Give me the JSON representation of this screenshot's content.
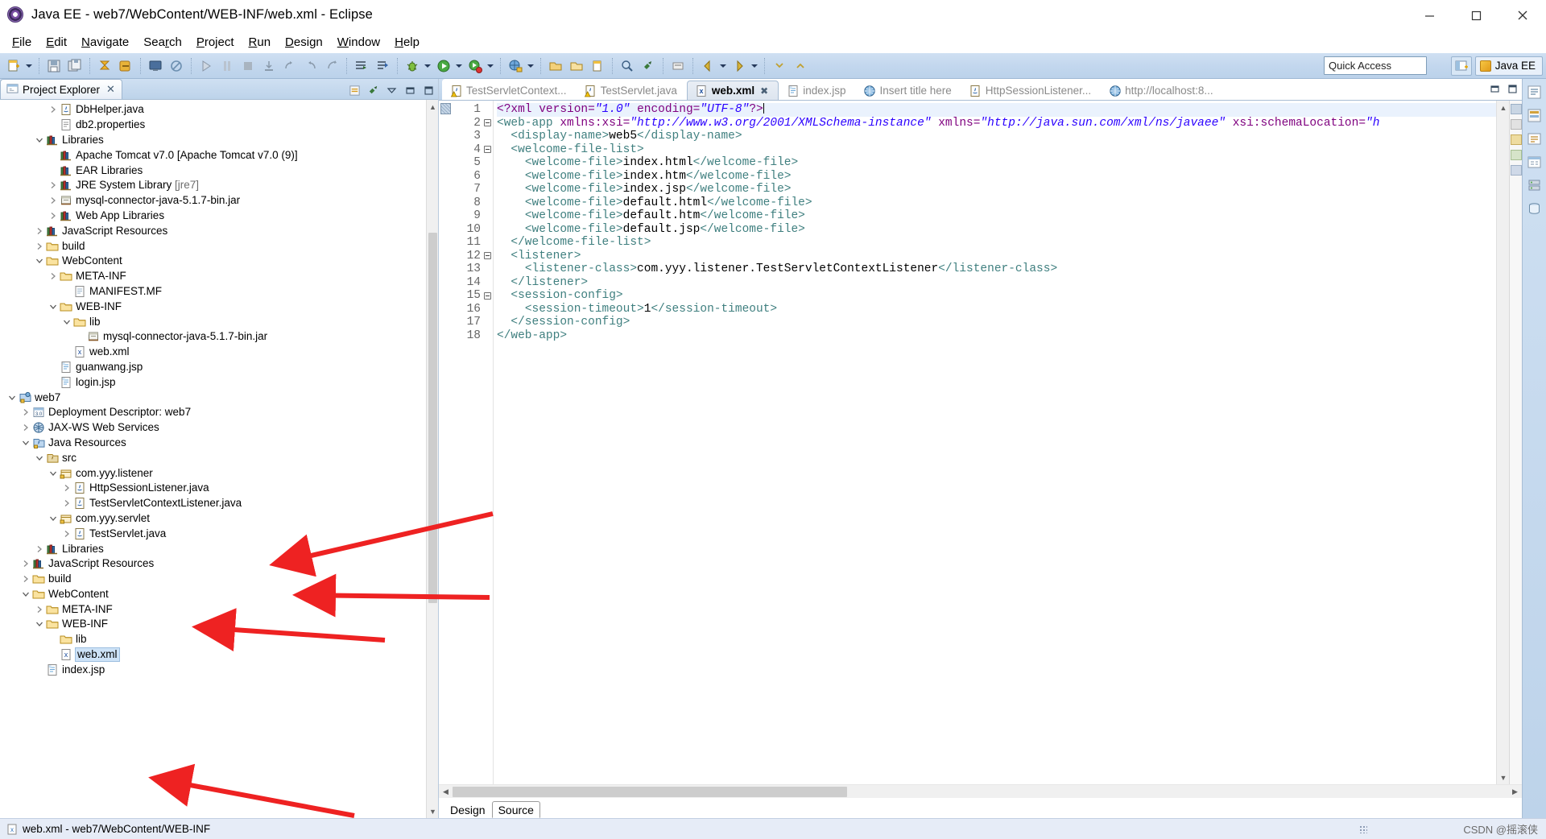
{
  "window": {
    "title": "Java EE - web7/WebContent/WEB-INF/web.xml - Eclipse",
    "app_icon": "eclipse-logo-icon",
    "minimize": "–",
    "maximize": "❐",
    "close": "✕"
  },
  "menubar": {
    "items": [
      {
        "label": "File",
        "mnemonic": "F"
      },
      {
        "label": "Edit",
        "mnemonic": "E"
      },
      {
        "label": "Navigate",
        "mnemonic": "N"
      },
      {
        "label": "Search",
        "mnemonic": "r"
      },
      {
        "label": "Project",
        "mnemonic": "P"
      },
      {
        "label": "Run",
        "mnemonic": "R"
      },
      {
        "label": "Design",
        "mnemonic": "D"
      },
      {
        "label": "Window",
        "mnemonic": "W"
      },
      {
        "label": "Help",
        "mnemonic": "H"
      }
    ]
  },
  "toolbar": {
    "quick_access_placeholder": "Quick Access",
    "perspective_label": "Java EE",
    "open_perspective_tooltip": "Open Perspective",
    "icons": [
      "new-wizard-icon",
      "save-icon",
      "save-all-icon",
      "publish-icon",
      "publish-all-icon",
      "console-icon",
      "no-sign-icon",
      "run-server-icon",
      "pause-icon",
      "stop-icon",
      "step-into-icon",
      "step-over-icon",
      "step-return-icon",
      "resume-icon",
      "open-type-icon",
      "open-task-icon",
      "debug-icon",
      "run-icon",
      "run-config-icon",
      "external-tools-icon",
      "new-java-project-icon",
      "new-package-icon",
      "new-class-icon",
      "search-icon",
      "link-icon",
      "back-icon",
      "forward-icon",
      "annotation-icon",
      "next-annotation-icon",
      "prev-annotation-icon"
    ]
  },
  "project_explorer": {
    "tab_title": "Project Explorer",
    "tab_icon": "project-explorer-icon",
    "tab_close": "✕",
    "tools": [
      "collapse-all-icon",
      "link-with-editor-icon",
      "view-menu-icon",
      "minimize-icon",
      "maximize-icon"
    ],
    "rows": [
      {
        "indent": 3,
        "twist": "collapsed",
        "icon": "java-file-icon",
        "label": "DbHelper.java",
        "selected": false
      },
      {
        "indent": 3,
        "twist": "none",
        "icon": "properties-icon",
        "label": "db2.properties",
        "selected": false
      },
      {
        "indent": 2,
        "twist": "expanded",
        "icon": "libraries-icon",
        "label": "Libraries",
        "selected": false
      },
      {
        "indent": 3,
        "twist": "none",
        "icon": "library-icon",
        "label": "Apache Tomcat v7.0 [Apache Tomcat v7.0 (9)]",
        "selected": false
      },
      {
        "indent": 3,
        "twist": "none",
        "icon": "library-icon",
        "label": "EAR Libraries",
        "selected": false
      },
      {
        "indent": 3,
        "twist": "collapsed",
        "icon": "library-icon",
        "label": "JRE System Library ",
        "label_dim": "[jre7]",
        "selected": false
      },
      {
        "indent": 3,
        "twist": "collapsed",
        "icon": "jar-icon",
        "label": "mysql-connector-java-5.1.7-bin.jar",
        "selected": false
      },
      {
        "indent": 3,
        "twist": "collapsed",
        "icon": "library-icon",
        "label": "Web App Libraries",
        "selected": false
      },
      {
        "indent": 2,
        "twist": "collapsed",
        "icon": "libraries-icon",
        "label": "JavaScript Resources",
        "selected": false
      },
      {
        "indent": 2,
        "twist": "collapsed",
        "icon": "folder-icon",
        "label": "build",
        "selected": false
      },
      {
        "indent": 2,
        "twist": "expanded",
        "icon": "folder-icon",
        "label": "WebContent",
        "selected": false
      },
      {
        "indent": 3,
        "twist": "collapsed",
        "icon": "folder-icon",
        "label": "META-INF",
        "selected": false
      },
      {
        "indent": 4,
        "twist": "none",
        "icon": "file-icon",
        "label": "MANIFEST.MF",
        "selected": false
      },
      {
        "indent": 3,
        "twist": "expanded",
        "icon": "folder-icon",
        "label": "WEB-INF",
        "selected": false
      },
      {
        "indent": 4,
        "twist": "expanded",
        "icon": "folder-icon",
        "label": "lib",
        "selected": false
      },
      {
        "indent": 5,
        "twist": "none",
        "icon": "jar-icon",
        "label": "mysql-connector-java-5.1.7-bin.jar",
        "selected": false
      },
      {
        "indent": 4,
        "twist": "none",
        "icon": "xml-icon",
        "label": "web.xml",
        "selected": false
      },
      {
        "indent": 3,
        "twist": "none",
        "icon": "jsp-icon",
        "label": "guanwang.jsp",
        "selected": false
      },
      {
        "indent": 3,
        "twist": "none",
        "icon": "jsp-icon",
        "label": "login.jsp",
        "selected": false
      },
      {
        "indent": 0,
        "twist": "expanded",
        "icon": "project-icon",
        "label": "web7",
        "selected": false
      },
      {
        "indent": 1,
        "twist": "collapsed",
        "icon": "deployment-icon",
        "label": "Deployment Descriptor: web7",
        "selected": false
      },
      {
        "indent": 1,
        "twist": "collapsed",
        "icon": "jaxws-icon",
        "label": "JAX-WS Web Services",
        "selected": false
      },
      {
        "indent": 1,
        "twist": "expanded",
        "icon": "java-res-icon",
        "label": "Java Resources",
        "selected": false
      },
      {
        "indent": 2,
        "twist": "expanded",
        "icon": "src-folder-icon",
        "label": "src",
        "selected": false
      },
      {
        "indent": 3,
        "twist": "expanded",
        "icon": "package-icon",
        "label": "com.yyy.listener",
        "selected": false
      },
      {
        "indent": 4,
        "twist": "collapsed",
        "icon": "java-file-icon",
        "label": "HttpSessionListener.java",
        "selected": false
      },
      {
        "indent": 4,
        "twist": "collapsed",
        "icon": "java-file-icon",
        "label": "TestServletContextListener.java",
        "selected": false
      },
      {
        "indent": 3,
        "twist": "expanded",
        "icon": "package-icon",
        "label": "com.yyy.servlet",
        "selected": false
      },
      {
        "indent": 4,
        "twist": "collapsed",
        "icon": "java-file-icon",
        "label": "TestServlet.java",
        "selected": false
      },
      {
        "indent": 2,
        "twist": "collapsed",
        "icon": "libraries-icon",
        "label": "Libraries",
        "selected": false
      },
      {
        "indent": 1,
        "twist": "collapsed",
        "icon": "libraries-icon",
        "label": "JavaScript Resources",
        "selected": false
      },
      {
        "indent": 1,
        "twist": "collapsed",
        "icon": "folder-icon",
        "label": "build",
        "selected": false
      },
      {
        "indent": 1,
        "twist": "expanded",
        "icon": "folder-icon",
        "label": "WebContent",
        "selected": false
      },
      {
        "indent": 2,
        "twist": "collapsed",
        "icon": "folder-icon",
        "label": "META-INF",
        "selected": false
      },
      {
        "indent": 2,
        "twist": "expanded",
        "icon": "folder-icon",
        "label": "WEB-INF",
        "selected": false
      },
      {
        "indent": 3,
        "twist": "none",
        "icon": "folder-icon",
        "label": "lib",
        "selected": false
      },
      {
        "indent": 3,
        "twist": "none",
        "icon": "xml-icon",
        "label": "web.xml",
        "selected": true
      },
      {
        "indent": 2,
        "twist": "none",
        "icon": "jsp-icon",
        "label": "index.jsp",
        "selected": false
      }
    ]
  },
  "editor": {
    "tabs": [
      {
        "label": "TestServletContext...",
        "icon": "java-warn-icon",
        "active": false
      },
      {
        "label": "TestServlet.java",
        "icon": "java-warn-icon",
        "active": false
      },
      {
        "label": "web.xml",
        "icon": "xml-icon",
        "active": true,
        "close": "✖"
      },
      {
        "label": "index.jsp",
        "icon": "jsp-icon",
        "active": false
      },
      {
        "label": "Insert title here",
        "icon": "web-icon",
        "active": false
      },
      {
        "label": "HttpSessionListener...",
        "icon": "java-icon",
        "active": false
      },
      {
        "label": "http://localhost:8...",
        "icon": "web-icon",
        "active": false
      }
    ],
    "bottom_tabs": [
      {
        "label": "Design",
        "active": false
      },
      {
        "label": "Source",
        "active": true
      }
    ],
    "lines": [
      {
        "no": 1,
        "fold": false,
        "highlight": true,
        "tokens": [
          [
            "ptag",
            "<?xml "
          ],
          [
            "attr",
            "version="
          ],
          [
            "val",
            "\"1.0\""
          ],
          [
            "txt",
            " "
          ],
          [
            "attr",
            "encoding="
          ],
          [
            "val",
            "\"UTF-8\""
          ],
          [
            "ptag",
            "?>"
          ],
          [
            "caret",
            ""
          ]
        ]
      },
      {
        "no": 2,
        "fold": true,
        "highlight": false,
        "tokens": [
          [
            "tag",
            "<web-app "
          ],
          [
            "attr",
            "xmlns:xsi="
          ],
          [
            "val",
            "\"http://www.w3.org/2001/XMLSchema-instance\""
          ],
          [
            "txt",
            " "
          ],
          [
            "attr",
            "xmlns="
          ],
          [
            "val",
            "\"http://java.sun.com/xml/ns/javaee\""
          ],
          [
            "txt",
            " "
          ],
          [
            "attr",
            "xsi:schemaLocation="
          ],
          [
            "val",
            "\"h"
          ]
        ]
      },
      {
        "no": 3,
        "fold": false,
        "highlight": false,
        "tokens": [
          [
            "txt",
            "  "
          ],
          [
            "tag",
            "<display-name>"
          ],
          [
            "txt",
            "web5"
          ],
          [
            "tag",
            "</display-name>"
          ]
        ]
      },
      {
        "no": 4,
        "fold": true,
        "highlight": false,
        "tokens": [
          [
            "txt",
            "  "
          ],
          [
            "tag",
            "<welcome-file-list>"
          ]
        ]
      },
      {
        "no": 5,
        "fold": false,
        "highlight": false,
        "tokens": [
          [
            "txt",
            "    "
          ],
          [
            "tag",
            "<welcome-file>"
          ],
          [
            "txt",
            "index.html"
          ],
          [
            "tag",
            "</welcome-file>"
          ]
        ]
      },
      {
        "no": 6,
        "fold": false,
        "highlight": false,
        "tokens": [
          [
            "txt",
            "    "
          ],
          [
            "tag",
            "<welcome-file>"
          ],
          [
            "txt",
            "index.htm"
          ],
          [
            "tag",
            "</welcome-file>"
          ]
        ]
      },
      {
        "no": 7,
        "fold": false,
        "highlight": false,
        "tokens": [
          [
            "txt",
            "    "
          ],
          [
            "tag",
            "<welcome-file>"
          ],
          [
            "txt",
            "index.jsp"
          ],
          [
            "tag",
            "</welcome-file>"
          ]
        ]
      },
      {
        "no": 8,
        "fold": false,
        "highlight": false,
        "tokens": [
          [
            "txt",
            "    "
          ],
          [
            "tag",
            "<welcome-file>"
          ],
          [
            "txt",
            "default.html"
          ],
          [
            "tag",
            "</welcome-file>"
          ]
        ]
      },
      {
        "no": 9,
        "fold": false,
        "highlight": false,
        "tokens": [
          [
            "txt",
            "    "
          ],
          [
            "tag",
            "<welcome-file>"
          ],
          [
            "txt",
            "default.htm"
          ],
          [
            "tag",
            "</welcome-file>"
          ]
        ]
      },
      {
        "no": 10,
        "fold": false,
        "highlight": false,
        "tokens": [
          [
            "txt",
            "    "
          ],
          [
            "tag",
            "<welcome-file>"
          ],
          [
            "txt",
            "default.jsp"
          ],
          [
            "tag",
            "</welcome-file>"
          ]
        ]
      },
      {
        "no": 11,
        "fold": false,
        "highlight": false,
        "tokens": [
          [
            "txt",
            "  "
          ],
          [
            "tag",
            "</welcome-file-list>"
          ]
        ]
      },
      {
        "no": 12,
        "fold": true,
        "highlight": false,
        "tokens": [
          [
            "txt",
            "  "
          ],
          [
            "tag",
            "<listener>"
          ]
        ]
      },
      {
        "no": 13,
        "fold": false,
        "highlight": false,
        "tokens": [
          [
            "txt",
            "    "
          ],
          [
            "tag",
            "<listener-class>"
          ],
          [
            "txt",
            "com.yyy.listener.TestServletContextListener"
          ],
          [
            "tag",
            "</listener-class>"
          ]
        ]
      },
      {
        "no": 14,
        "fold": false,
        "highlight": false,
        "tokens": [
          [
            "txt",
            "  "
          ],
          [
            "tag",
            "</listener>"
          ]
        ]
      },
      {
        "no": 15,
        "fold": true,
        "highlight": false,
        "tokens": [
          [
            "txt",
            "  "
          ],
          [
            "tag",
            "<session-config>"
          ]
        ]
      },
      {
        "no": 16,
        "fold": false,
        "highlight": false,
        "tokens": [
          [
            "txt",
            "    "
          ],
          [
            "tag",
            "<session-timeout>"
          ],
          [
            "txt",
            "1"
          ],
          [
            "tag",
            "</session-timeout>"
          ]
        ]
      },
      {
        "no": 17,
        "fold": false,
        "highlight": false,
        "tokens": [
          [
            "txt",
            "  "
          ],
          [
            "tag",
            "</session-config>"
          ]
        ]
      },
      {
        "no": 18,
        "fold": false,
        "highlight": false,
        "tokens": [
          [
            "tag",
            "</web-app>"
          ]
        ]
      }
    ]
  },
  "statusbar": {
    "icon": "xml-icon",
    "text": "web.xml - web7/WebContent/WEB-INF",
    "watermark": "CSDN @摇滚侠"
  },
  "annotations": {
    "arrow_color": "#ee2222",
    "arrows": [
      {
        "name": "arrow-to-httpsessionlistener"
      },
      {
        "name": "arrow-to-testservletcontextlistener"
      },
      {
        "name": "arrow-to-testservlet"
      },
      {
        "name": "arrow-to-webxml"
      }
    ]
  }
}
